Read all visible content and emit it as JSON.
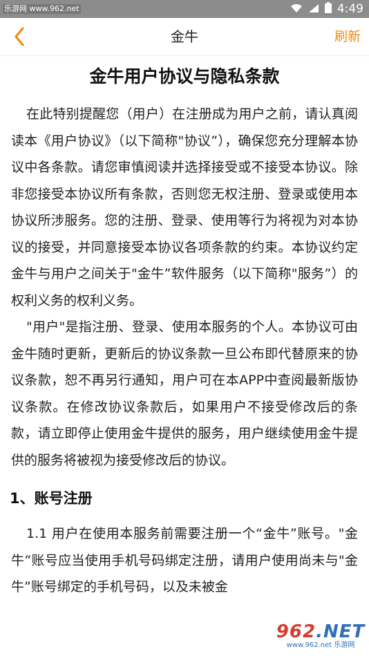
{
  "status_bar": {
    "watermark": "乐游网 www.962.net",
    "time": "4:49",
    "icons": [
      "wifi-icon",
      "signal-icon",
      "battery-icon"
    ]
  },
  "app_bar": {
    "title": "金牛",
    "refresh_label": "刷新",
    "accent_color": "#f08a12"
  },
  "document": {
    "title": "金牛用户协议与隐私条款",
    "paragraphs": [
      "在此特别提醒您（用户）在注册成为用户之前，请认真阅读本《用户协议》（以下简称\"协议”），确保您充分理解本协议中各条款。请您审慎阅读并选择接受或不接受本协议。除非您接受本协议所有条款，否则您无权注册、登录或使用本协议所涉服务。您的注册、登录、使用等行为将视为对本协议的接受，并同意接受本协议各项条款的约束。本协议约定金牛与用户之间关于\"金牛”软件服务（以下简称\"服务”）的权利义务的权利义务。",
      "\"用户\"是指注册、登录、使用本服务的个人。本协议可由金牛随时更新，更新后的协议条款一旦公布即代替原来的协议条款，恕不再另行通知，用户可在本APP中查阅最新版协议条款。在修改协议条款后，如果用户不接受修改后的条款，请立即停止使用金牛提供的服务，用户继续使用金牛提供的服务将被视为接受修改后的协议。"
    ],
    "section_1": {
      "heading": "1、账号注册",
      "paragraph": "1.1 用户在使用本服务前需要注册一个“金牛”账号。\"金牛”账号应当使用手机号码绑定注册，请用户使用尚未与\"金牛”账号绑定的手机号码，以及未被金"
    }
  },
  "watermark_logo": {
    "brand_main": "962",
    "brand_suffix": ".NET",
    "site": "www.962.net 乐游网"
  }
}
